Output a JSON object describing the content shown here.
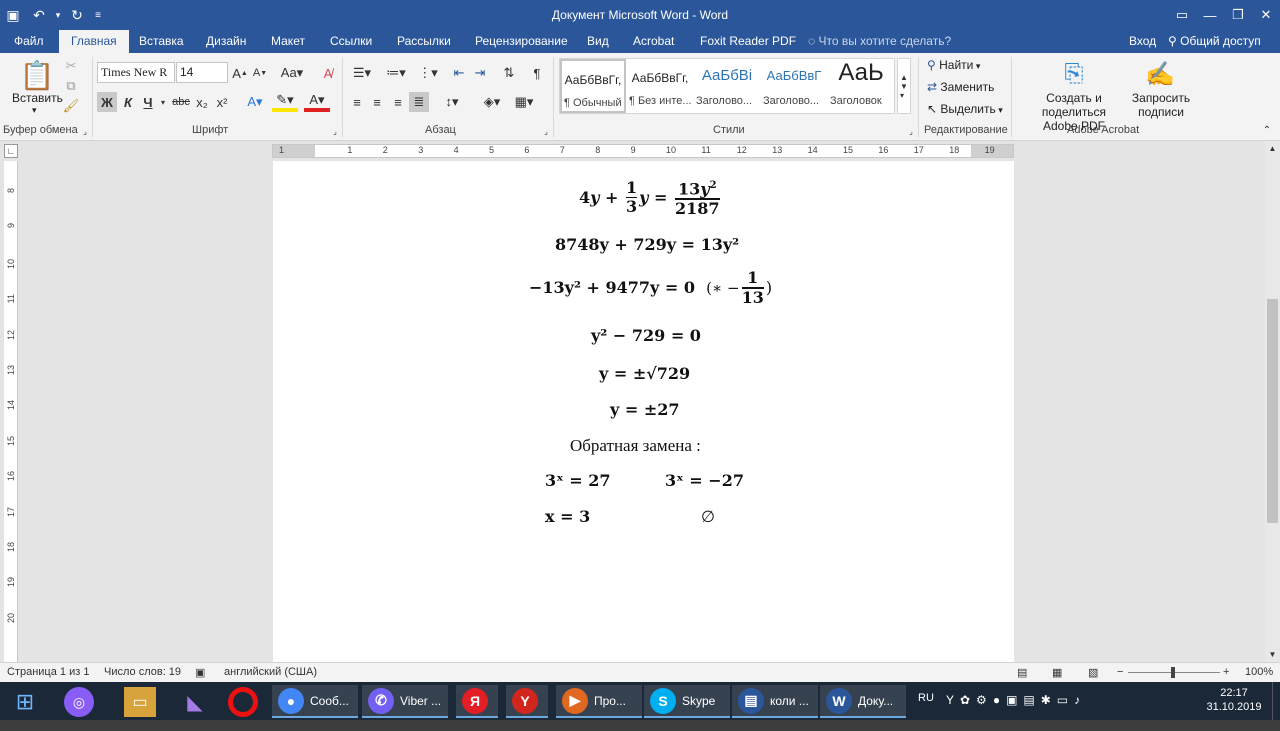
{
  "window": {
    "title": "Документ Microsoft Word - Word"
  },
  "ribbon_tabs": [
    "Файл",
    "Главная",
    "Вставка",
    "Дизайн",
    "Макет",
    "Ссылки",
    "Рассылки",
    "Рецензирование",
    "Вид",
    "Acrobat",
    "Foxit Reader PDF"
  ],
  "tell_me": "Что вы хотите сделать?",
  "sign_in": "Вход",
  "share": "Общий доступ",
  "clipboard": {
    "paste": "Вставить",
    "label": "Буфер обмена"
  },
  "font": {
    "name": "Times New R",
    "size": "14",
    "label": "Шрифт",
    "bold": "Ж",
    "italic": "К",
    "underline": "Ч",
    "strike": "abc",
    "sub": "x₂",
    "sup": "x²"
  },
  "paragraph": {
    "label": "Абзац"
  },
  "styles": {
    "label": "Стили",
    "items": [
      {
        "preview": "АаБбВвГг,",
        "name": "¶ Обычный"
      },
      {
        "preview": "АаБбВвГг,",
        "name": "¶ Без инте..."
      },
      {
        "preview": "АаБбВі",
        "name": "Заголово..."
      },
      {
        "preview": "АаБбВвГ",
        "name": "Заголово..."
      },
      {
        "preview": "АаЬ",
        "name": "Заголовок"
      }
    ]
  },
  "editing": {
    "label": "Редактирование",
    "find": "Найти",
    "replace": "Заменить",
    "select": "Выделить"
  },
  "acrobat": {
    "label": "Adobe Acrobat",
    "create": "Создать и поделиться",
    "create2": "Adobe PDF",
    "request": "Запросить",
    "request2": "подписи"
  },
  "ruler": {
    "h_ticks": [
      "1",
      "1",
      "2",
      "3",
      "4",
      "5",
      "6",
      "7",
      "8",
      "9",
      "10",
      "11",
      "12",
      "13",
      "14",
      "15",
      "16",
      "17",
      "18",
      "19"
    ],
    "v_ticks": [
      "8",
      "9",
      "10",
      "11",
      "12",
      "13",
      "14",
      "15",
      "16",
      "17",
      "18",
      "19",
      "20"
    ]
  },
  "document": {
    "reverse_sub": "Обратная замена :",
    "e1_a": "4",
    "e1_b": "+",
    "e1_n": "1",
    "e1_d": "3",
    "e1_c": "=",
    "e1_tn": "13",
    "e1_td": "2187",
    "e2": "8748y + 729y = 13y²",
    "e3": "−13y² + 9477y = 0",
    "e3_mul": "(∗ −",
    "e3_n": "1",
    "e3_d": "13",
    "e3_close": ")",
    "e4": "y² − 729 = 0",
    "e5": "y = ±√729",
    "e6": "y = ±27",
    "e7a": "3ˣ = 27",
    "e7b": "3ˣ = −27",
    "e8a": "x = 3",
    "e8b": "∅"
  },
  "status": {
    "page": "Страница 1 из 1",
    "words": "Число слов: 19",
    "lang": "английский (США)",
    "zoom": "100%"
  },
  "taskbar": {
    "items": [
      {
        "label": "Сооб...",
        "color": "#4285f4",
        "glyph": "●"
      },
      {
        "label": "Viber ...",
        "color": "#7360f2",
        "glyph": "✆"
      },
      {
        "label": "",
        "color": "#e31e24",
        "glyph": "Я"
      },
      {
        "label": "",
        "color": "#d1261d",
        "glyph": "Y"
      },
      {
        "label": "Про...",
        "color": "#e06820",
        "glyph": "▶"
      },
      {
        "label": "Skype",
        "color": "#00aff0",
        "glyph": "S"
      },
      {
        "label": "коли ...",
        "color": "#2b579a",
        "glyph": "▤"
      },
      {
        "label": "Доку...",
        "color": "#2b579a",
        "glyph": "W"
      }
    ],
    "lang": "RU",
    "time": "22:17",
    "date": "31.10.2019"
  }
}
